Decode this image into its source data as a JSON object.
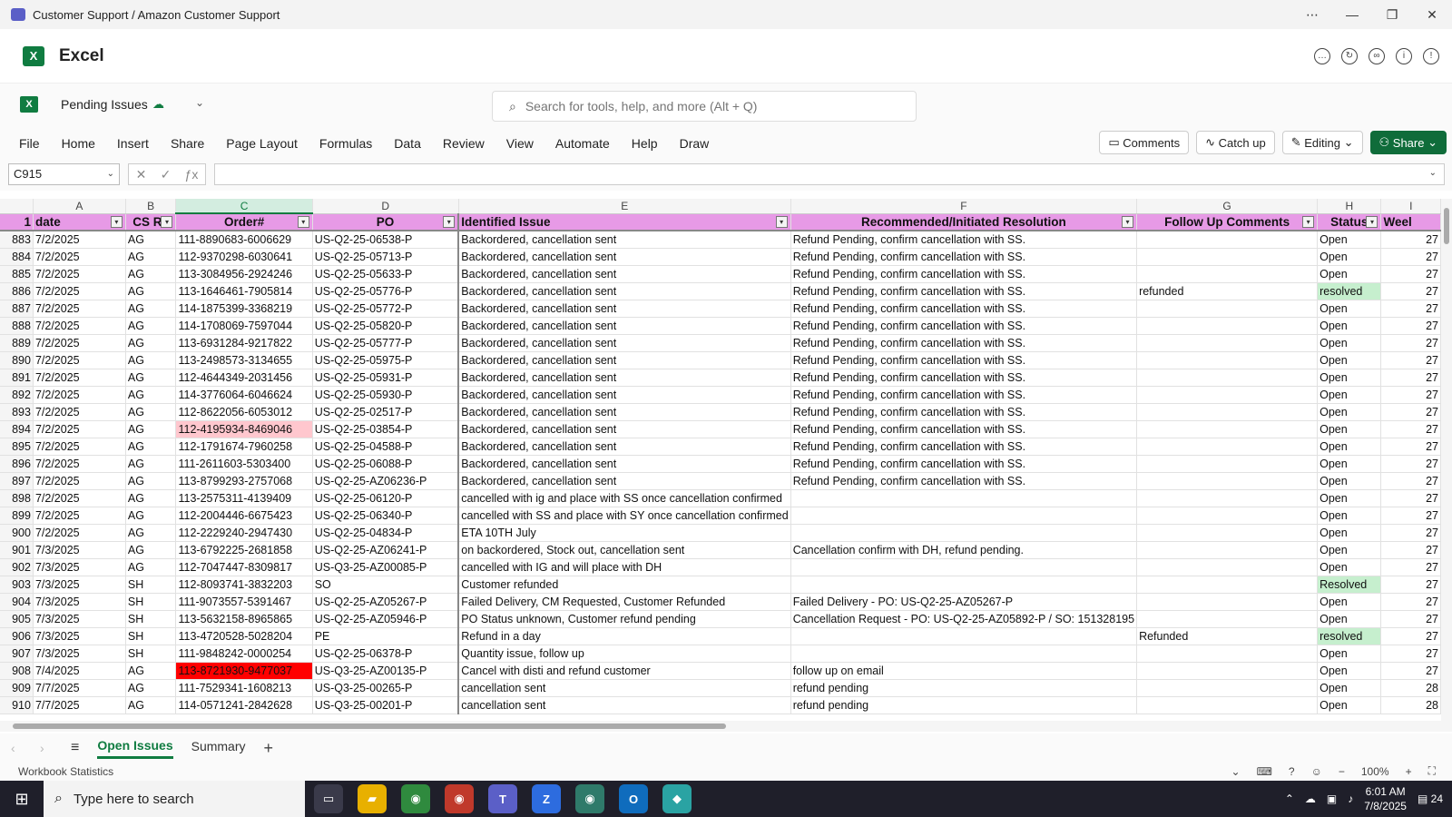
{
  "window": {
    "title": "Customer Support / Amazon Customer Support"
  },
  "app": {
    "name": "Excel"
  },
  "doc": {
    "name": "Pending Issues"
  },
  "search": {
    "placeholder": "Search for tools, help, and more (Alt + Q)"
  },
  "ribbon": {
    "tabs": [
      "File",
      "Home",
      "Insert",
      "Share",
      "Page Layout",
      "Formulas",
      "Data",
      "Review",
      "View",
      "Automate",
      "Help",
      "Draw"
    ],
    "comments_label": "Comments",
    "catchup_label": "Catch up",
    "editing_label": "Editing",
    "share_label": "Share"
  },
  "formula": {
    "cell_ref": "C915",
    "value": ""
  },
  "sheet": {
    "column_letters": [
      "A",
      "B",
      "C",
      "D",
      "E",
      "F",
      "G",
      "H",
      "I"
    ],
    "header_row_number": "1",
    "headers": [
      "date",
      "CS Re",
      "Order#",
      "PO",
      "Identified Issue",
      "Recommended/Initiated Resolution",
      "Follow Up Comments",
      "Status",
      "Weel"
    ],
    "rows": [
      {
        "n": "883",
        "a": "7/2/2025",
        "b": "AG",
        "c": "111-8890683-6006629",
        "d": "US-Q2-25-06538-P",
        "e": "Backordered, cancellation sent",
        "f": "Refund Pending, confirm cancellation with SS.",
        "g": "",
        "h": "Open",
        "i": "27"
      },
      {
        "n": "884",
        "a": "7/2/2025",
        "b": "AG",
        "c": "112-9370298-6030641",
        "d": "US-Q2-25-05713-P",
        "e": "Backordered, cancellation sent",
        "f": "Refund Pending, confirm cancellation with SS.",
        "g": "",
        "h": "Open",
        "i": "27"
      },
      {
        "n": "885",
        "a": "7/2/2025",
        "b": "AG",
        "c": "113-3084956-2924246",
        "d": "US-Q2-25-05633-P",
        "e": "Backordered, cancellation sent",
        "f": "Refund Pending, confirm cancellation with SS.",
        "g": "",
        "h": "Open",
        "i": "27"
      },
      {
        "n": "886",
        "a": "7/2/2025",
        "b": "AG",
        "c": "113-1646461-7905814",
        "d": "US-Q2-25-05776-P",
        "e": "Backordered, cancellation sent",
        "f": "Refund Pending, confirm cancellation with SS.",
        "g": "refunded",
        "h": "resolved",
        "i": "27"
      },
      {
        "n": "887",
        "a": "7/2/2025",
        "b": "AG",
        "c": "114-1875399-3368219",
        "d": "US-Q2-25-05772-P",
        "e": "Backordered, cancellation sent",
        "f": "Refund Pending, confirm cancellation with SS.",
        "g": "",
        "h": "Open",
        "i": "27"
      },
      {
        "n": "888",
        "a": "7/2/2025",
        "b": "AG",
        "c": "114-1708069-7597044",
        "d": "US-Q2-25-05820-P",
        "e": "Backordered, cancellation sent",
        "f": "Refund Pending, confirm cancellation with SS.",
        "g": "",
        "h": "Open",
        "i": "27"
      },
      {
        "n": "889",
        "a": "7/2/2025",
        "b": "AG",
        "c": "113-6931284-9217822",
        "d": "US-Q2-25-05777-P",
        "e": "Backordered, cancellation sent",
        "f": "Refund Pending, confirm cancellation with SS.",
        "g": "",
        "h": "Open",
        "i": "27"
      },
      {
        "n": "890",
        "a": "7/2/2025",
        "b": "AG",
        "c": "113-2498573-3134655",
        "d": "US-Q2-25-05975-P",
        "e": "Backordered, cancellation sent",
        "f": "Refund Pending, confirm cancellation with SS.",
        "g": "",
        "h": "Open",
        "i": "27"
      },
      {
        "n": "891",
        "a": "7/2/2025",
        "b": "AG",
        "c": "112-4644349-2031456",
        "d": "US-Q2-25-05931-P",
        "e": "Backordered, cancellation sent",
        "f": "Refund Pending, confirm cancellation with SS.",
        "g": "",
        "h": "Open",
        "i": "27"
      },
      {
        "n": "892",
        "a": "7/2/2025",
        "b": "AG",
        "c": "114-3776064-6046624",
        "d": "US-Q2-25-05930-P",
        "e": "Backordered, cancellation sent",
        "f": "Refund Pending, confirm cancellation with SS.",
        "g": "",
        "h": "Open",
        "i": "27"
      },
      {
        "n": "893",
        "a": "7/2/2025",
        "b": "AG",
        "c": "112-8622056-6053012",
        "d": "US-Q2-25-02517-P",
        "e": "Backordered, cancellation sent",
        "f": "Refund Pending, confirm cancellation with SS.",
        "g": "",
        "h": "Open",
        "i": "27"
      },
      {
        "n": "894",
        "a": "7/2/2025",
        "b": "AG",
        "c": "112-4195934-8469046",
        "d": "US-Q2-25-03854-P",
        "e": "Backordered, cancellation sent",
        "f": "Refund Pending, confirm cancellation with SS.",
        "g": "",
        "h": "Open",
        "i": "27",
        "c_style": "pink"
      },
      {
        "n": "895",
        "a": "7/2/2025",
        "b": "AG",
        "c": "112-1791674-7960258",
        "d": "US-Q2-25-04588-P",
        "e": "Backordered, cancellation sent",
        "f": "Refund Pending, confirm cancellation with SS.",
        "g": "",
        "h": "Open",
        "i": "27"
      },
      {
        "n": "896",
        "a": "7/2/2025",
        "b": "AG",
        "c": "111-2611603-5303400",
        "d": "US-Q2-25-06088-P",
        "e": "Backordered, cancellation sent",
        "f": "Refund Pending, confirm cancellation with SS.",
        "g": "",
        "h": "Open",
        "i": "27"
      },
      {
        "n": "897",
        "a": "7/2/2025",
        "b": "AG",
        "c": "113-8799293-2757068",
        "d": "US-Q2-25-AZ06236-P",
        "e": "Backordered, cancellation sent",
        "f": "Refund Pending, confirm cancellation with SS.",
        "g": "",
        "h": "Open",
        "i": "27"
      },
      {
        "n": "898",
        "a": "7/2/2025",
        "b": "AG",
        "c": "113-2575311-4139409",
        "d": "US-Q2-25-06120-P",
        "e": "cancelled with ig and place with SS once cancellation confirmed",
        "f": "",
        "g": "",
        "h": "Open",
        "i": "27",
        "e_ovf": true
      },
      {
        "n": "899",
        "a": "7/2/2025",
        "b": "AG",
        "c": "112-2004446-6675423",
        "d": "US-Q2-25-06340-P",
        "e": "cancelled with SS and place with SY once cancellation confirmed",
        "f": "",
        "g": "",
        "h": "Open",
        "i": "27",
        "e_ovf": true
      },
      {
        "n": "900",
        "a": "7/2/2025",
        "b": "AG",
        "c": "112-2229240-2947430",
        "d": "US-Q2-25-04834-P",
        "e": "ETA 10TH July",
        "f": "",
        "g": "",
        "h": "Open",
        "i": "27"
      },
      {
        "n": "901",
        "a": "7/3/2025",
        "b": "AG",
        "c": "113-6792225-2681858",
        "d": "US-Q2-25-AZ06241-P",
        "e": "on backordered, Stock out, cancellation sent",
        "f": "Cancellation confirm with DH, refund pending.",
        "g": "",
        "h": "Open",
        "i": "27"
      },
      {
        "n": "902",
        "a": "7/3/2025",
        "b": "AG",
        "c": "112-7047447-8309817",
        "d": "US-Q3-25-AZ00085-P",
        "e": "cancelled with IG and will place with DH",
        "f": "",
        "g": "",
        "h": "Open",
        "i": "27"
      },
      {
        "n": "903",
        "a": "7/3/2025",
        "b": "SH",
        "c": "112-8093741-3832203",
        "d": "SO",
        "e": "Customer refunded",
        "f": "",
        "g": "",
        "h": "Resolved",
        "i": "27"
      },
      {
        "n": "904",
        "a": "7/3/2025",
        "b": "SH",
        "c": "111-9073557-5391467",
        "d": "US-Q2-25-AZ05267-P",
        "e": "Failed Delivery, CM Requested, Customer Refunded",
        "f": "Failed Delivery - PO: US-Q2-25-AZ05267-P",
        "g": "",
        "h": "Open",
        "i": "27"
      },
      {
        "n": "905",
        "a": "7/3/2025",
        "b": "SH",
        "c": "113-5632158-8965865",
        "d": "US-Q2-25-AZ05946-P",
        "e": "PO Status unknown, Customer refund pending",
        "f": "Cancellation Request - PO: US-Q2-25-AZ05892-P / SO: 151328195",
        "g": "",
        "h": "Open",
        "i": "27",
        "f_ovf": true
      },
      {
        "n": "906",
        "a": "7/3/2025",
        "b": "SH",
        "c": "113-4720528-5028204",
        "d": "PE",
        "e": "Refund in a day",
        "f": "",
        "g": "Refunded",
        "h": "resolved",
        "i": "27"
      },
      {
        "n": "907",
        "a": "7/3/2025",
        "b": "SH",
        "c": "111-9848242-0000254",
        "d": "US-Q2-25-06378-P",
        "e": "Quantity issue, follow up",
        "f": "",
        "g": "",
        "h": "Open",
        "i": "27"
      },
      {
        "n": "908",
        "a": "7/4/2025",
        "b": "AG",
        "c": "113-8721930-9477037",
        "d": "US-Q3-25-AZ00135-P",
        "e": "Cancel with disti and refund customer",
        "f": "follow up on email",
        "g": "",
        "h": "Open",
        "i": "27",
        "c_style": "red"
      },
      {
        "n": "909",
        "a": "7/7/2025",
        "b": "AG",
        "c": "111-7529341-1608213",
        "d": "US-Q3-25-00265-P",
        "e": "cancellation sent",
        "f": "refund pending",
        "g": "",
        "h": "Open",
        "i": "28"
      },
      {
        "n": "910",
        "a": "7/7/2025",
        "b": "AG",
        "c": "114-0571241-2842628",
        "d": "US-Q3-25-00201-P",
        "e": "cancellation sent",
        "f": "refund pending",
        "g": "",
        "h": "Open",
        "i": "28"
      }
    ]
  },
  "sheet_tabs": {
    "tabs": [
      "Open Issues",
      "Summary"
    ],
    "active": "Open Issues"
  },
  "statusbar": {
    "left": "Workbook Statistics",
    "zoom": "100%"
  },
  "taskbar": {
    "search_placeholder": "Type here to search",
    "time": "6:01 AM",
    "date": "7/8/2025",
    "notifications": "24"
  },
  "colors": {
    "accent": "#107c41",
    "header_fill": "#e79ae6",
    "resolved_fill": "#c6efce",
    "pink_fill": "#ffc7ce",
    "red_fill": "#ff0000"
  }
}
